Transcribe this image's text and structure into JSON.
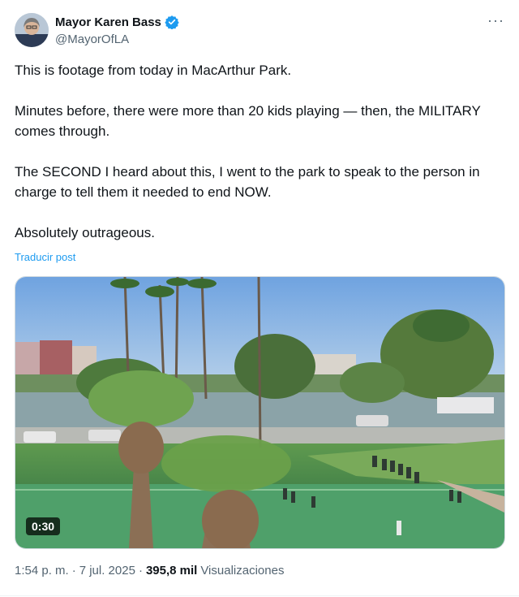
{
  "author": {
    "name": "Mayor Karen Bass",
    "handle": "@MayorOfLA"
  },
  "tweet": {
    "paragraphs": [
      "This is footage from today in MacArthur Park.",
      "Minutes before, there were more than 20 kids playing — then, the MILITARY comes through.",
      "The SECOND I heard about this, I went to the park to speak to the person in charge to tell them it needed to end NOW.",
      "Absolutely outrageous."
    ],
    "translate_label": "Traducir post"
  },
  "media": {
    "duration": "0:30"
  },
  "meta": {
    "time": "1:54 p. m.",
    "separator1": "·",
    "date": "7 jul. 2025",
    "separator2": "·",
    "views_count": "395,8 mil",
    "views_label": "Visualizaciones"
  },
  "icons": {
    "verified": "verified-badge-icon",
    "more": "more-options-icon"
  },
  "colors": {
    "accent": "#1d9bf0",
    "text": "#0f1419",
    "secondary": "#536471"
  }
}
